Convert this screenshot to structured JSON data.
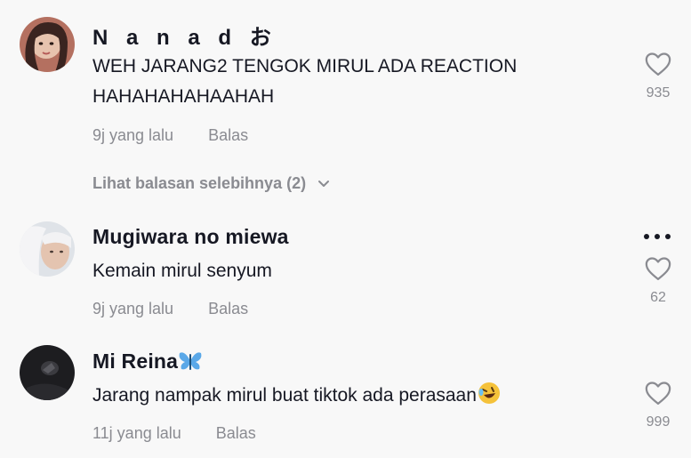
{
  "comments": [
    {
      "username": "N a n a d お",
      "text": "WEH JARANG2 TENGOK MIRUL ADA REACTION HAHAHAHAHAAHAH",
      "time": "9j yang lalu",
      "reply_label": "Balas",
      "likes": "935",
      "view_replies": "Lihat balasan selebihnya (2)"
    },
    {
      "username": "Mugiwara no miewa",
      "text": "Kemain mirul senyum",
      "time": "9j yang lalu",
      "reply_label": "Balas",
      "likes": "62"
    },
    {
      "username": "Mi Reina",
      "text": "Jarang nampak mirul buat tiktok ada perasaan",
      "time": "11j yang lalu",
      "reply_label": "Balas",
      "likes": "999"
    }
  ],
  "icons": {
    "like": "heart-outline-icon",
    "more": "more-horizontal-icon",
    "chevron": "chevron-down-icon",
    "butterfly": "butterfly-emoji",
    "laugh": "rolling-laughing-emoji"
  },
  "colors": {
    "text": "#161823",
    "muted": "#8a8b91",
    "background": "#f8f8f8"
  }
}
